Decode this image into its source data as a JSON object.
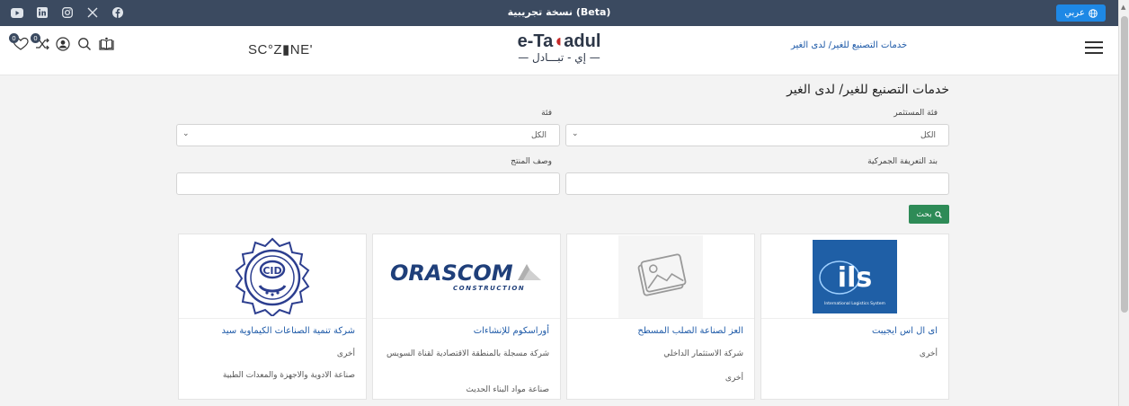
{
  "topbar": {
    "beta_label": "نسخة تجريبية (Beta)",
    "language_label": "عربي",
    "social_icons": [
      "youtube-icon",
      "linkedin-icon",
      "instagram-icon",
      "x-icon",
      "facebook-icon"
    ]
  },
  "header": {
    "compare_count": "0",
    "wishlist_count": "0",
    "partner_logo": "SC°Z▮NE'",
    "logo_line1_a": "e-Ta",
    "logo_line1_b": "adul",
    "logo_line2": "— إي - تبـــادل —",
    "breadcrumb": "خدمات التصنيع للغير/ لدى الغير"
  },
  "filters": {
    "page_title": "خدمات التصنيع للغير/ لدى الغير",
    "investor_category_label": "فئة المستثمر",
    "investor_category_value": "الكل",
    "category_label": "فئة",
    "category_value": "الكل",
    "hs_code_label": "بند التعريفة الجمركية",
    "product_desc_label": "وصف المنتج",
    "search_label": "بحث"
  },
  "cards": [
    {
      "logo": "ILS International Logistics System",
      "name": "اى ال اس ايجيبت",
      "type": "أخرى",
      "sector": ""
    },
    {
      "logo": "placeholder",
      "name": "العز لصناعة الصلب المسطح",
      "type": "شركة الاستثمار الداخلي",
      "sector": "أخرى"
    },
    {
      "logo": "ORASCOM CONSTRUCTION",
      "name": "أوراسكوم للإنشاءات",
      "type": "شركة مسجلة بالمنطقة الاقتصادية لقناة السويس",
      "sector": "صناعة مواد البناء الحديث"
    },
    {
      "logo": "CID",
      "name": "شركة تنمية الصناعات الكيماوية سيد",
      "type": "أخرى",
      "sector": "صناعة الادوية والاجهزة والمعدات الطبية"
    }
  ],
  "colors": {
    "topbar": "#3b4a60",
    "accent_blue": "#1e88e5",
    "link_blue": "#1e5aa8",
    "search_green": "#2e8b57",
    "logo_red": "#c62828"
  }
}
